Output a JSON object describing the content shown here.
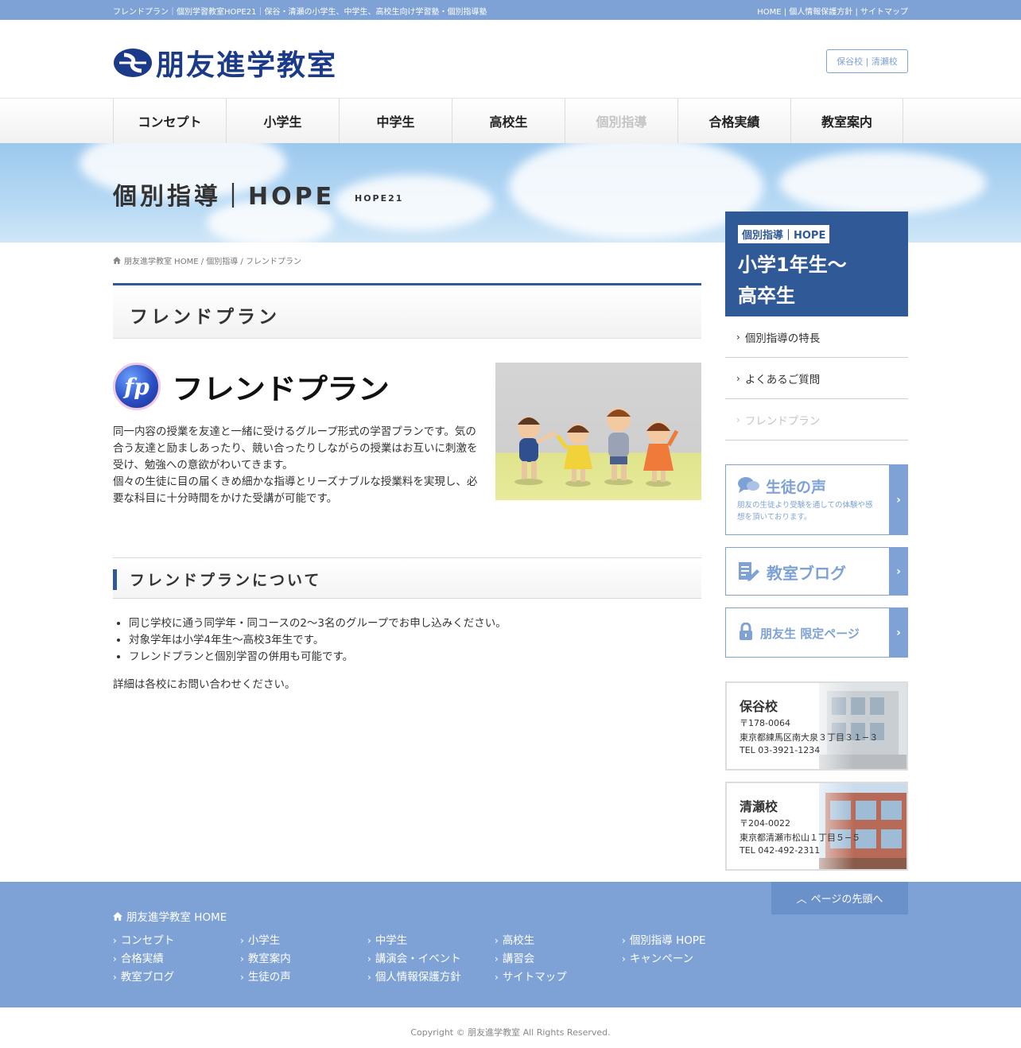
{
  "topbar": {
    "description": "フレンドプラン｜個別学習教室HOPE21｜保谷・清瀬の小学生、中学生、高校生向け学習塾・個別指導塾",
    "links": "HOME | 個人情報保護方針 | サイトマップ"
  },
  "header": {
    "logo_text": "朋友進学教室",
    "schools_button": "保谷校 | 清瀬校"
  },
  "nav": [
    {
      "label": "コンセプト"
    },
    {
      "label": "小学生"
    },
    {
      "label": "中学生"
    },
    {
      "label": "高校生"
    },
    {
      "label": "個別指導"
    },
    {
      "label": "合格実績"
    },
    {
      "label": "教室案内"
    }
  ],
  "nav_current_index": 4,
  "hero": {
    "title": "個別指導｜HOPE",
    "subtitle": "HOPE21"
  },
  "breadcrumb": "朋友進学教室 HOME / 個別指導 / フレンドプラン",
  "main": {
    "page_title": "フレンドプラン",
    "fp_mark": "fp",
    "fp_name": "フレンドプラン",
    "intro": [
      "同一内容の授業を友達と一緒に受けるグループ形式の学習プランです。気の合う友達と励ましあったり、競い合ったりしながらの授業はお互いに刺激を受け、勉強への意欲がわいてきます。",
      "個々の生徒に目の届くきめ細かな指導とリーズナブルな授業料を実現し、必要な科目に十分時間をかけた受講が可能です。"
    ],
    "section_title": "フレンドプランについて",
    "bullets": [
      "同じ学校に通う同学年・同コースの2〜3名のグループでお申し込みください。",
      "対象学年は小学4年生〜高校3年生です。",
      "フレンドプランと個別学習の併用も可能です。"
    ],
    "note": "詳細は各校にお問い合わせください。"
  },
  "sidebar": {
    "tag": "個別指導｜HOPE",
    "big_line1": "小学1年生〜",
    "big_line2": "高卒生",
    "menu": [
      {
        "label": "個別指導の特長"
      },
      {
        "label": "よくあるご質問"
      },
      {
        "label": "フレンドプラン"
      }
    ],
    "menu_current_index": 2,
    "voice": {
      "title": "生徒の声",
      "sub": "朋友の生徒より受験を通しての体験や感想を頂いております。"
    },
    "blog": {
      "title": "教室ブログ"
    },
    "members": {
      "title": "朋友生 限定ページ"
    },
    "schools": [
      {
        "name": "保谷校",
        "zip": "〒178-0064",
        "address": "東京都練馬区南大泉３丁目３１−３",
        "tel": "TEL 03-3921-1234"
      },
      {
        "name": "清瀬校",
        "zip": "〒204-0022",
        "address": "東京都清瀬市松山１丁目５−５",
        "tel": "TEL 042-492-2311"
      }
    ]
  },
  "footer": {
    "pagetop": "ページの先頭へ",
    "home": "朋友進学教室 HOME",
    "columns": [
      [
        "コンセプト",
        "合格実績",
        "教室ブログ"
      ],
      [
        "小学生",
        "教室案内",
        "生徒の声"
      ],
      [
        "中学生",
        "講演会・イベント",
        "個人情報保護方針"
      ],
      [
        "高校生",
        "講習会",
        "サイトマップ"
      ],
      [
        "個別指導 HOPE",
        "キャンペーン"
      ]
    ],
    "copyright": "Copyright © 朋友進学教室 All Rights Reserved."
  },
  "colors": {
    "brand_blue": "#2f5a97",
    "accent_light_blue": "#7ea2d6",
    "logo_navy": "#1c3a8a"
  }
}
